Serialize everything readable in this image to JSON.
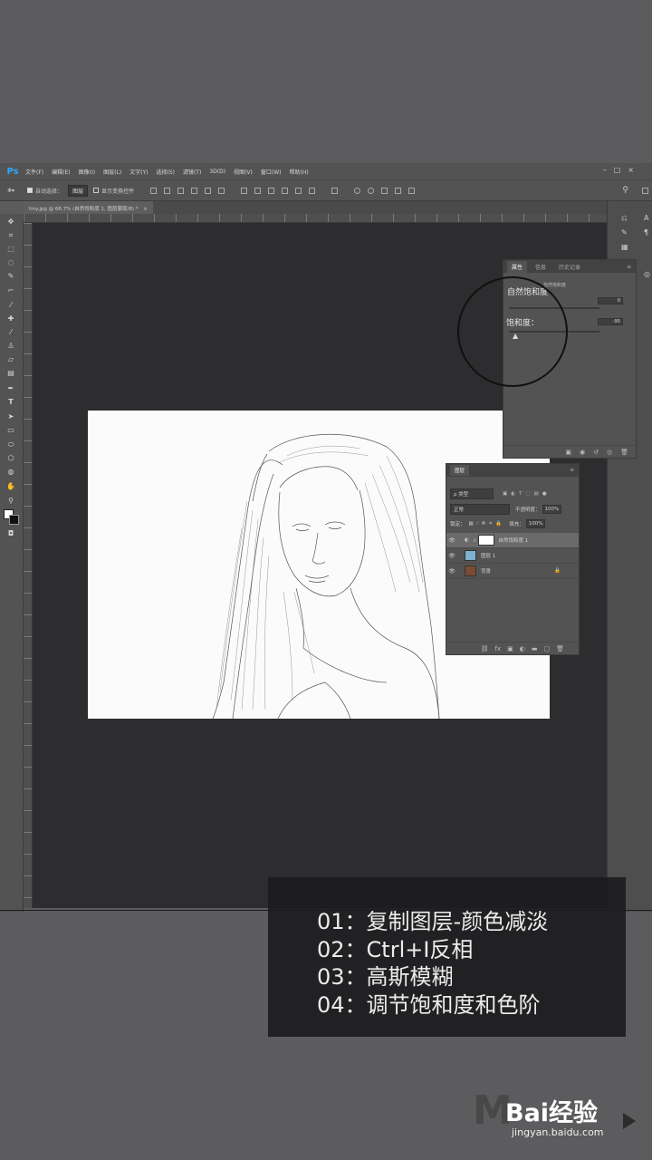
{
  "app": {
    "logo": "Ps"
  },
  "menubar": {
    "items": [
      "文件(F)",
      "编辑(E)",
      "图像(I)",
      "图层(L)",
      "文字(Y)",
      "选择(S)",
      "滤镜(T)",
      "3D(D)",
      "视图(V)",
      "窗口(W)",
      "帮助(H)"
    ]
  },
  "options": {
    "auto_select": "自动选择：",
    "layer_select": "图层",
    "transform": "显示变换控件"
  },
  "document": {
    "tab_title": "tiny.jpg @ 66.7% (自然饱和度 1, 图层蒙版/8) *"
  },
  "properties_panel": {
    "tabs": [
      "属性",
      "信息",
      "历史记录"
    ],
    "title": "自然饱和度",
    "vibrance_label": "自然饱和度",
    "vibrance_value": "0",
    "saturation_label": "饱和度：",
    "saturation_value": "-95"
  },
  "layers_panel": {
    "tab": "图层",
    "filter_kind": "ρ 类型",
    "blend_mode": "正常",
    "opacity_label": "不透明度：",
    "opacity_value": "100%",
    "lock_label": "锁定：",
    "fill_label": "填充：",
    "fill_value": "100%",
    "layers": [
      {
        "name": "自然饱和度 1",
        "selected": true
      },
      {
        "name": "图层 1",
        "selected": false
      },
      {
        "name": "背景",
        "selected": false
      }
    ]
  },
  "caption": {
    "lines": [
      "01：复制图层-颜色减淡",
      "02：Ctrl+I反相",
      "03：高斯模糊",
      "04：调节饱和度和色阶"
    ]
  },
  "watermark": {
    "brand": "Bai经验",
    "url": "jingyan.baidu.com"
  }
}
